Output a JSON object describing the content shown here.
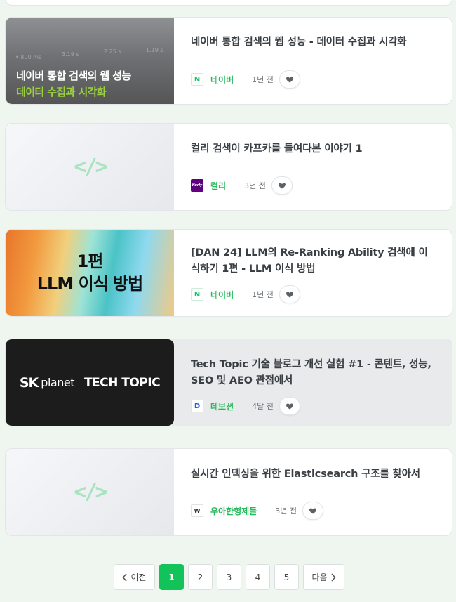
{
  "posts": [
    {
      "title": "네이버 통합 검색의 웹 성능 - 데이터 수집과 시각화",
      "thumb_line1": "네이버 통합 검색의 웹 성능",
      "thumb_line2": "데이터 수집과 시각화",
      "thumb_bg_text": [
        "• 800 ms",
        "3.19 s",
        "2.25 s",
        "1.19 s"
      ],
      "source": "네이버",
      "source_logo": "N",
      "time": "1년 전"
    },
    {
      "title": "컬리 검색이 카프카를 들여다본 이야기 1",
      "thumb_glyph": "</>",
      "source": "컬리",
      "source_logo": "Kurly",
      "time": "3년 전"
    },
    {
      "title": "[DAN 24] LLM의 Re-Ranking Ability 검색에 이식하기 1편 - LLM 이식 방법",
      "thumb_line1": "1편",
      "thumb_line2": "LLM 이식 방법",
      "source": "네이버",
      "source_logo": "N",
      "time": "1년 전"
    },
    {
      "title": "Tech Topic 기술 블로그 개선 실험 #1 - 콘텐트, 성능, SEO 및 AEO 관점에서",
      "thumb_sk": "SK",
      "thumb_planet": "planet",
      "thumb_tt": "TECH TOPIC",
      "source": "데보션",
      "source_logo": "D",
      "time": "4달 전"
    },
    {
      "title": "실시간 인덱싱을 위한 Elasticsearch 구조를 찾아서",
      "thumb_glyph": "</>",
      "source": "우아한형제들",
      "source_logo": "W",
      "time": "3년 전"
    }
  ],
  "pagination": {
    "prev": "이전",
    "next": "다음",
    "pages": [
      "1",
      "2",
      "3",
      "4",
      "5"
    ],
    "current": "1"
  },
  "colors": {
    "accent": "#12c35a",
    "source_text": "#22b95a",
    "naver_green": "#03c75a",
    "kurly_purple": "#5f0080",
    "devocean_blue": "#1e5fd6"
  },
  "icons": {
    "like": "heart-icon",
    "prev": "chevron-left-icon",
    "next": "chevron-right-icon"
  }
}
